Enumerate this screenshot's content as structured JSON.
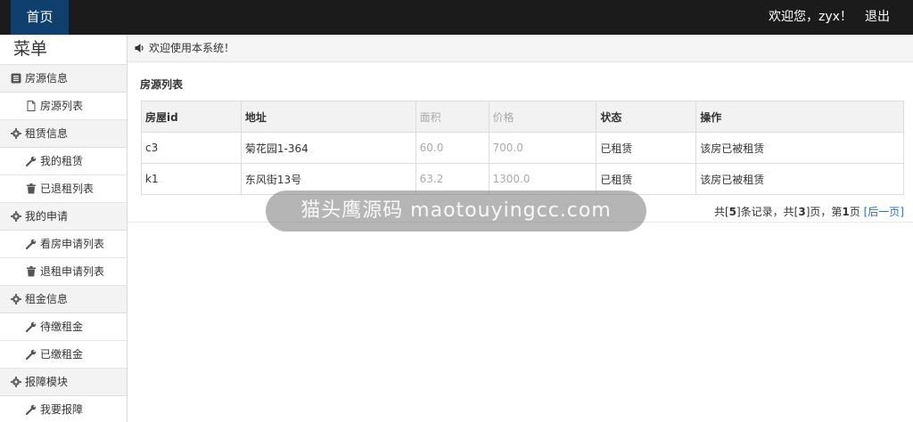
{
  "header": {
    "home_label": "首页",
    "welcome_text": "欢迎您，zyx！",
    "logout_label": "退出"
  },
  "sidebar": {
    "title": "菜单",
    "groups": [
      {
        "label": "房源信息",
        "icon": "list-icon",
        "items": [
          {
            "label": "房源列表",
            "icon": "file-icon"
          }
        ]
      },
      {
        "label": "租赁信息",
        "icon": "gear-icon",
        "items": [
          {
            "label": "我的租赁",
            "icon": "wrench-icon"
          },
          {
            "label": "已退租列表",
            "icon": "trash-icon"
          }
        ]
      },
      {
        "label": "我的申请",
        "icon": "gear-icon",
        "items": [
          {
            "label": "看房申请列表",
            "icon": "wrench-icon"
          },
          {
            "label": "退租申请列表",
            "icon": "trash-icon"
          }
        ]
      },
      {
        "label": "租金信息",
        "icon": "gear-icon",
        "items": [
          {
            "label": "待缴租金",
            "icon": "wrench-icon"
          },
          {
            "label": "已缴租金",
            "icon": "wrench-icon"
          }
        ]
      },
      {
        "label": "报障模块",
        "icon": "gear-icon",
        "items": [
          {
            "label": "我要报障",
            "icon": "wrench-icon"
          }
        ]
      }
    ]
  },
  "main": {
    "notice": "欢迎使用本系统！",
    "notice_icon": "speaker-icon",
    "list_title": "房源列表",
    "table": {
      "headers": [
        "房屋id",
        "地址",
        "面积",
        "价格",
        "状态",
        "操作"
      ],
      "rows": [
        [
          "c3",
          "菊花园1-364",
          "60.0",
          "700.0",
          "已租赁",
          "该房已被租赁"
        ],
        [
          "k1",
          "东风街13号",
          "63.2",
          "1300.0",
          "已租赁",
          "该房已被租赁"
        ]
      ]
    },
    "pager": {
      "prefix": "共[",
      "total": "5",
      "mid1": "]条记录，共[",
      "pages": "3",
      "mid2": "]页，第",
      "current": "1",
      "suffix": "页",
      "next_label": "[后一页]"
    }
  },
  "watermark": "猫头鹰源码 maotouyingcc.com",
  "colors": {
    "topbar": "#1b1b1b",
    "home_tab": "#0e3f6d",
    "link": "#2a6fc1"
  }
}
